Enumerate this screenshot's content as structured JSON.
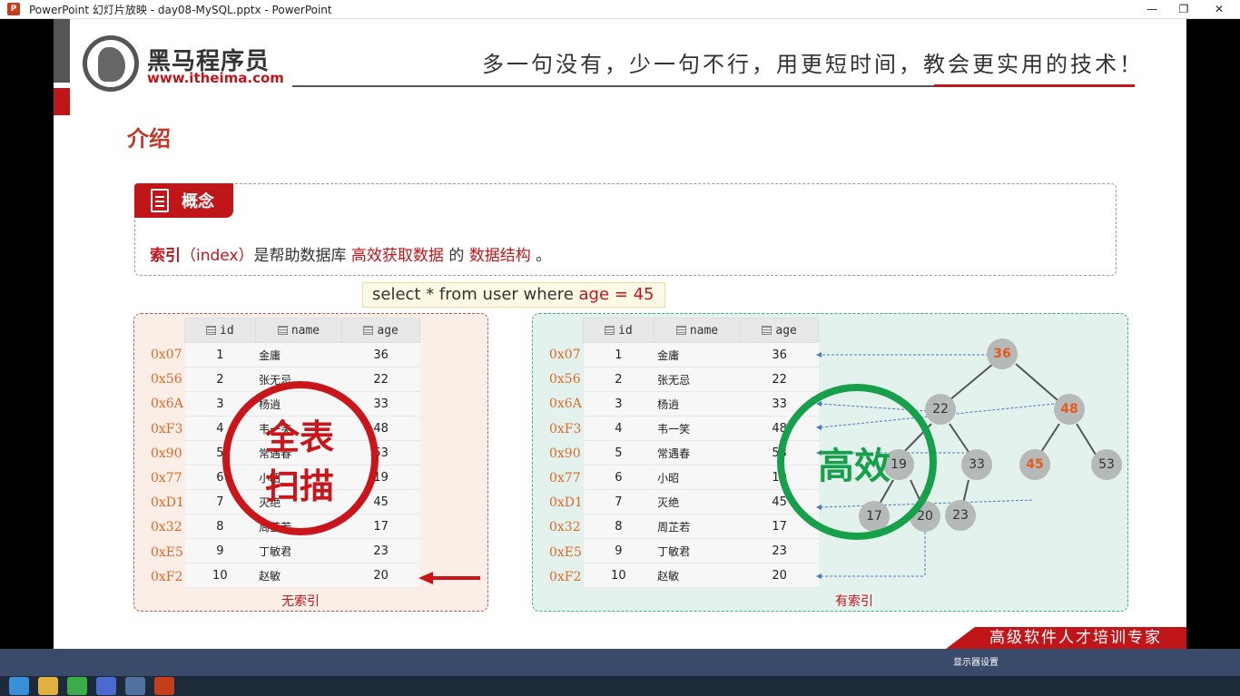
{
  "window": {
    "title": "PowerPoint 幻灯片放映 - day08-MySQL.pptx - PowerPoint",
    "app_icon": "P",
    "minimize": "—",
    "restore": "❐",
    "close": "✕"
  },
  "header": {
    "logo_cn": "黑马程序员",
    "logo_url": "www.itheima.com",
    "slogan": "多一句没有，少一句不行，用更短时间，教会更实用的技术！"
  },
  "heading": "介绍",
  "concept": {
    "tag": "概念",
    "term": "索引",
    "term_en": "（index）",
    "middle": "是帮助数据库",
    "highlight1": "高效获取数据",
    "de": "的",
    "highlight2": "数据结构",
    "end": "。"
  },
  "sql": {
    "prefix": "select * from user where ",
    "cond": "age = 45"
  },
  "table": {
    "columns": [
      "id",
      "name",
      "age"
    ],
    "rows": [
      {
        "addr": "0x07",
        "id": "1",
        "name": "金庸",
        "age": "36"
      },
      {
        "addr": "0x56",
        "id": "2",
        "name": "张无忌",
        "age": "22"
      },
      {
        "addr": "0x6A",
        "id": "3",
        "name": "杨逍",
        "age": "33"
      },
      {
        "addr": "0xF3",
        "id": "4",
        "name": "韦一笑",
        "age": "48"
      },
      {
        "addr": "0x90",
        "id": "5",
        "name": "常遇春",
        "age": "53"
      },
      {
        "addr": "0x77",
        "id": "6",
        "name": "小昭",
        "age": "19"
      },
      {
        "addr": "0xD1",
        "id": "7",
        "name": "灭绝",
        "age": "45"
      },
      {
        "addr": "0x32",
        "id": "8",
        "name": "周芷若",
        "age": "17"
      },
      {
        "addr": "0xE5",
        "id": "9",
        "name": "丁敏君",
        "age": "23"
      },
      {
        "addr": "0xF2",
        "id": "10",
        "name": "赵敏",
        "age": "20"
      }
    ]
  },
  "left_panel": {
    "caption": "无索引",
    "stamp_line1": "全表",
    "stamp_line2": "扫描"
  },
  "right_panel": {
    "caption": "有索引",
    "stamp": "高效",
    "tree_nodes": [
      "36",
      "22",
      "48",
      "19",
      "33",
      "45",
      "53",
      "17",
      "20",
      "23"
    ]
  },
  "footer": {
    "band": "高级软件人才培训专家"
  },
  "slideshow_bar": {
    "display_settings": "显示器设置"
  },
  "colors": {
    "brand_red": "#c0161a",
    "stamp_red": "#c8161a",
    "stamp_green": "#16a04a",
    "node_highlight": "#e65a1c"
  }
}
